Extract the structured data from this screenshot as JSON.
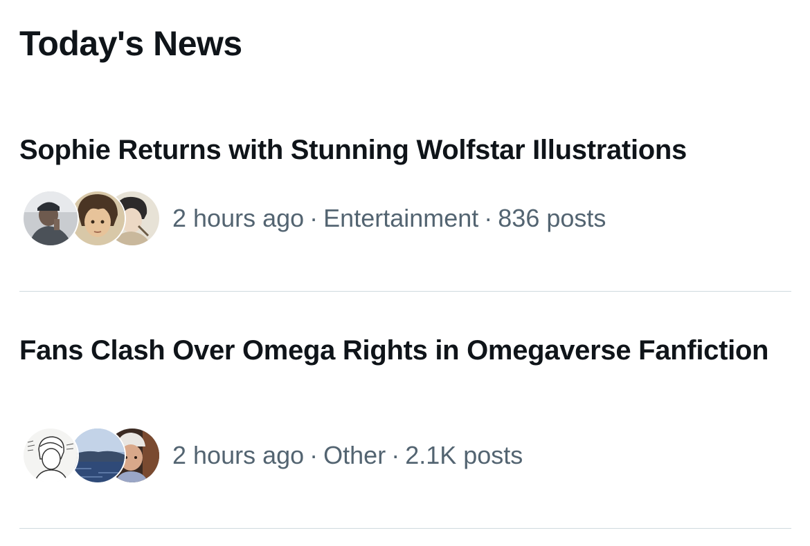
{
  "section": {
    "title": "Today's News"
  },
  "news": [
    {
      "headline": "Sophie Returns with Stunning Wolfstar Illustrations",
      "time": "2 hours ago",
      "category": "Entertainment",
      "posts": "836 posts",
      "separator": "·",
      "avatars": [
        "user-avatar",
        "user-avatar",
        "user-avatar"
      ]
    },
    {
      "headline": "Fans Clash Over Omega Rights in Omegaverse Fanfiction",
      "time": "2 hours ago",
      "category": "Other",
      "posts": "2.1K posts",
      "separator": "·",
      "avatars": [
        "user-avatar",
        "user-avatar",
        "user-avatar"
      ]
    }
  ],
  "colors": {
    "text_primary": "#0f1419",
    "text_secondary": "#536471",
    "divider": "#cfd9de"
  }
}
